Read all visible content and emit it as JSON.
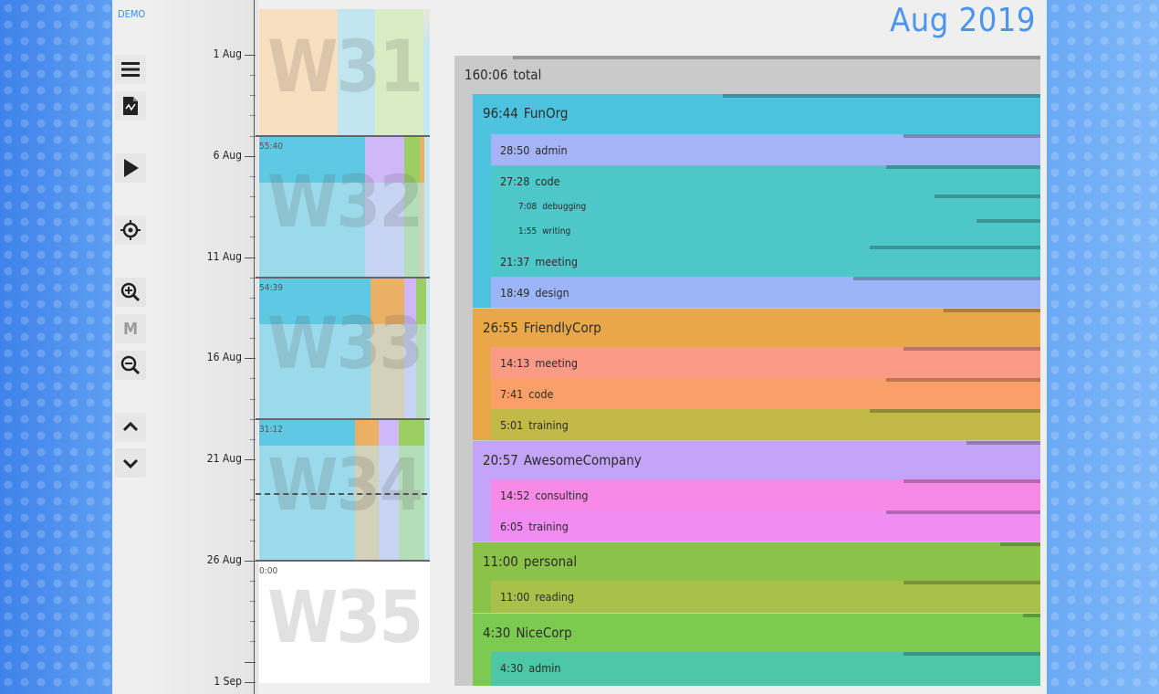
{
  "app": {
    "badge": "DEMO",
    "month_title": "Aug 2019"
  },
  "toolbar": {
    "menu": "menu-icon",
    "report": "report-icon",
    "play": "play-icon",
    "locate": "crosshair-icon",
    "zoom_in": "zoom-in-icon",
    "zoom_mode": "M",
    "zoom_out": "zoom-out-icon",
    "up": "chevron-up-icon",
    "down": "chevron-down-icon"
  },
  "timeline": {
    "date_labels": [
      "1 Aug",
      "6 Aug",
      "11 Aug",
      "16 Aug",
      "21 Aug",
      "26 Aug",
      "1 Sep"
    ],
    "weeks": [
      {
        "name": "W31",
        "total": ""
      },
      {
        "name": "W32",
        "total": "55:40"
      },
      {
        "name": "W33",
        "total": "54:39"
      },
      {
        "name": "W34",
        "total": "31:12"
      },
      {
        "name": "W35",
        "total": "0:00"
      }
    ]
  },
  "tree": {
    "total": {
      "duration": "160:06",
      "label": "total"
    },
    "orgs": [
      {
        "duration": "96:44",
        "label": "FunOrg",
        "color": "#4dc3df",
        "children": [
          {
            "duration": "28:50",
            "label": "admin",
            "color": "#a5b4f7"
          },
          {
            "duration": "27:28",
            "label": "code",
            "color": "#4ec7c9",
            "children": [
              {
                "duration": "7:08",
                "label": "debugging",
                "color": "#4ec7c9"
              },
              {
                "duration": "1:55",
                "label": "writing",
                "color": "#4ec7c9"
              }
            ]
          },
          {
            "duration": "21:37",
            "label": "meeting",
            "color": "#4ec7c9"
          },
          {
            "duration": "18:49",
            "label": "design",
            "color": "#9cb5f8"
          }
        ]
      },
      {
        "duration": "26:55",
        "label": "FriendlyCorp",
        "color": "#e8a84a",
        "children": [
          {
            "duration": "14:13",
            "label": "meeting",
            "color": "#f99b86"
          },
          {
            "duration": "7:41",
            "label": "code",
            "color": "#f9a068"
          },
          {
            "duration": "5:01",
            "label": "training",
            "color": "#c3b948"
          }
        ]
      },
      {
        "duration": "20:57",
        "label": "AwesomeCompany",
        "color": "#c3a4f8",
        "children": [
          {
            "duration": "14:52",
            "label": "consulting",
            "color": "#f78ae6"
          },
          {
            "duration": "6:05",
            "label": "training",
            "color": "#f08cf2"
          }
        ]
      },
      {
        "duration": "11:00",
        "label": "personal",
        "color": "#8bc34a",
        "children": [
          {
            "duration": "11:00",
            "label": "reading",
            "color": "#a9c14a"
          }
        ]
      },
      {
        "duration": "4:30",
        "label": "NiceCorp",
        "color": "#7ccb50",
        "children": [
          {
            "duration": "4:30",
            "label": "admin",
            "color": "#4ec7a7"
          }
        ]
      }
    ]
  }
}
